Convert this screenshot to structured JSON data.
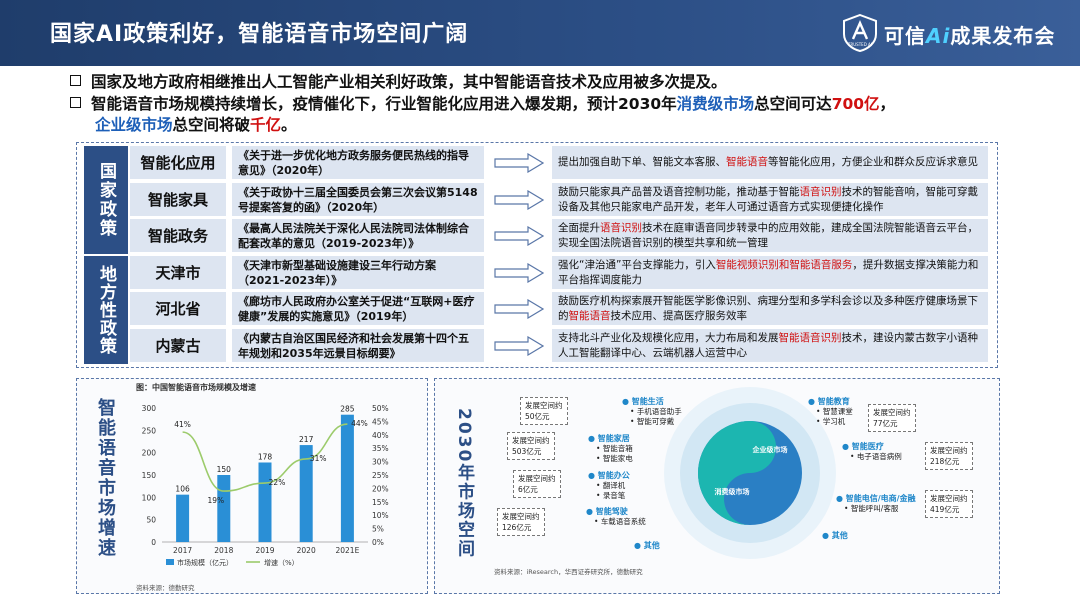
{
  "header": {
    "title": "国家AI政策利好，智能语音市场空间广阔",
    "brand_pre": "可信",
    "brand_ai": "Ai",
    "brand_post": "成果发布会",
    "logo_text": "TRUSTED AI"
  },
  "bullets": [
    {
      "plain": "国家及地方政府相继推出人工智能产业相关利好政策，其中智能语音技术及应用被多次提及。"
    },
    {
      "a": "智能语音市场规模持续增长，疫情催化下，行业智能化应用进入爆发期，预计2030年",
      "b": "消费级市场",
      "c": "总空间可达",
      "d": "700亿",
      "e": "，",
      "f": "企业级市场",
      "g": "总空间将破",
      "h": "千亿",
      "i": "。"
    }
  ],
  "policy": {
    "national_label": "国家政策",
    "local_label": "地方性政策",
    "rows": [
      {
        "name": "智能化应用",
        "doc": "《关于进一步优化地方政务服务便民热线的指导意见》（2020年）",
        "d1": "提出加强自助下单、智能文本客服、",
        "hl": "智能语音",
        "d2": "等智能化应用，方便企业和群众反应诉求意见"
      },
      {
        "name": "智能家具",
        "doc": "《关于政协十三届全国委员会第三次会议第5148号提案答复的函》（2020年）",
        "d1": "鼓励只能家具产品普及语音控制功能，推动基于智能",
        "hl": "语音识别",
        "d2": "技术的智能音响，智能可穿戴设备及其他只能家电产品开发，老年人可通过语音方式实现便捷化操作"
      },
      {
        "name": "智能政务",
        "doc": "《最高人民法院关于深化人民法院司法体制综合配套改革的意见（2019-2023年）》",
        "d1": "全面提升",
        "hl": "语音识别",
        "d2": "技术在庭审语音同步转录中的应用效能，建成全国法院智能语音云平台，实现全国法院语音识别的模型共享和统一管理"
      },
      {
        "name": "天津市",
        "doc": "《天津市新型基础设施建设三年行动方案（2021-2023年）》",
        "d1": "强化“津治通”平台支撑能力，引入",
        "hl": "智能视频识别和智能语音服务",
        "d2": "，提升数据支撑决策能力和平台指挥调度能力"
      },
      {
        "name": "河北省",
        "doc": "《廊坊市人民政府办公室关于促进“互联网+医疗健康”发展的实施意见》（2019年）",
        "d1": "鼓励医疗机构探索展开智能医学影像识别、病理分型和多学科会诊以及多种医疗健康场景下的",
        "hl": "智能语音",
        "d2": "技术应用、提高医疗服务效率"
      },
      {
        "name": "内蒙古",
        "doc": "《内蒙古自治区国民经济和社会发展第十四个五年规划和2035年远景目标纲要》",
        "d1": "支持北斗产业化及规模化应用，大力布局和发展",
        "hl": "智能语音识别",
        "d2": "技术，建设内蒙古数字小语种人工智能翻译中心、云端机器人运营中心"
      }
    ]
  },
  "left_panel": {
    "label": "智能语音市场增速",
    "chart_title": "图：中国智能语音市场规模及增速",
    "source": "资料来源：德勤研究"
  },
  "chart_data": {
    "type": "bar",
    "title": "图：中国智能语音市场规模及增速",
    "categories": [
      "2017",
      "2018",
      "2019",
      "2020",
      "2021E"
    ],
    "series": [
      {
        "name": "市场规模（亿元）",
        "type": "bar",
        "values": [
          106,
          150,
          178,
          217,
          285
        ]
      },
      {
        "name": "增速（%）",
        "type": "line",
        "values": [
          41,
          19,
          22,
          31,
          44
        ]
      }
    ],
    "y_left_ticks": [
      "0",
      "50",
      "100",
      "150",
      "200",
      "250",
      "300"
    ],
    "y_right_ticks": [
      "0%",
      "5%",
      "10%",
      "15%",
      "20%",
      "25%",
      "30%",
      "35%",
      "40%",
      "45%",
      "50%"
    ],
    "value_labels": [
      "106",
      "150",
      "178",
      "217",
      "285"
    ],
    "rate_labels": [
      "41%",
      "19%",
      "22%",
      "31%",
      "44%"
    ],
    "ylim_left": [
      0,
      300
    ],
    "ylim_right": [
      0,
      50
    ],
    "legend": "bottom-left",
    "colors": {
      "bar": "#2a8fd6",
      "line": "#9ccb6b"
    }
  },
  "right_panel": {
    "label": "2030年市场空间",
    "center_enterprise": "企业级市场",
    "center_consumer": "消费级市场",
    "source": "资料来源：iResearch，华西证券研究所，德勤研究",
    "categories": [
      {
        "id": "life",
        "title": "智能生活",
        "items": [
          "手机语音助手",
          "智能可穿戴"
        ]
      },
      {
        "id": "edu",
        "title": "智能教育",
        "items": [
          "智慧课堂",
          "学习机"
        ]
      },
      {
        "id": "home",
        "title": "智能家居",
        "items": [
          "智能音箱",
          "智能家电"
        ]
      },
      {
        "id": "medical",
        "title": "智能医疗",
        "items": [
          "电子语音病例"
        ]
      },
      {
        "id": "office",
        "title": "智能办公",
        "items": [
          "翻译机",
          "录音笔"
        ]
      },
      {
        "id": "telecom",
        "title": "智能电信/电商/金融",
        "items": [
          "智能呼叫/客服"
        ]
      },
      {
        "id": "drive",
        "title": "智能驾驶",
        "items": [
          "车载语音系统"
        ]
      },
      {
        "id": "other1",
        "title": "其他",
        "items": []
      },
      {
        "id": "other2",
        "title": "其他",
        "items": []
      }
    ],
    "amounts": [
      {
        "id": "a1",
        "text": "发展空间约",
        "value": "50亿元"
      },
      {
        "id": "a2",
        "text": "发展空间约",
        "value": "77亿元"
      },
      {
        "id": "a3",
        "text": "发展空间约",
        "value": "503亿元"
      },
      {
        "id": "a4",
        "text": "发展空间约",
        "value": "218亿元"
      },
      {
        "id": "a5",
        "text": "发展空间约",
        "value": "6亿元"
      },
      {
        "id": "a6",
        "text": "发展空间约",
        "value": "419亿元"
      },
      {
        "id": "a7",
        "text": "发展空间约",
        "value": "126亿元"
      }
    ]
  }
}
